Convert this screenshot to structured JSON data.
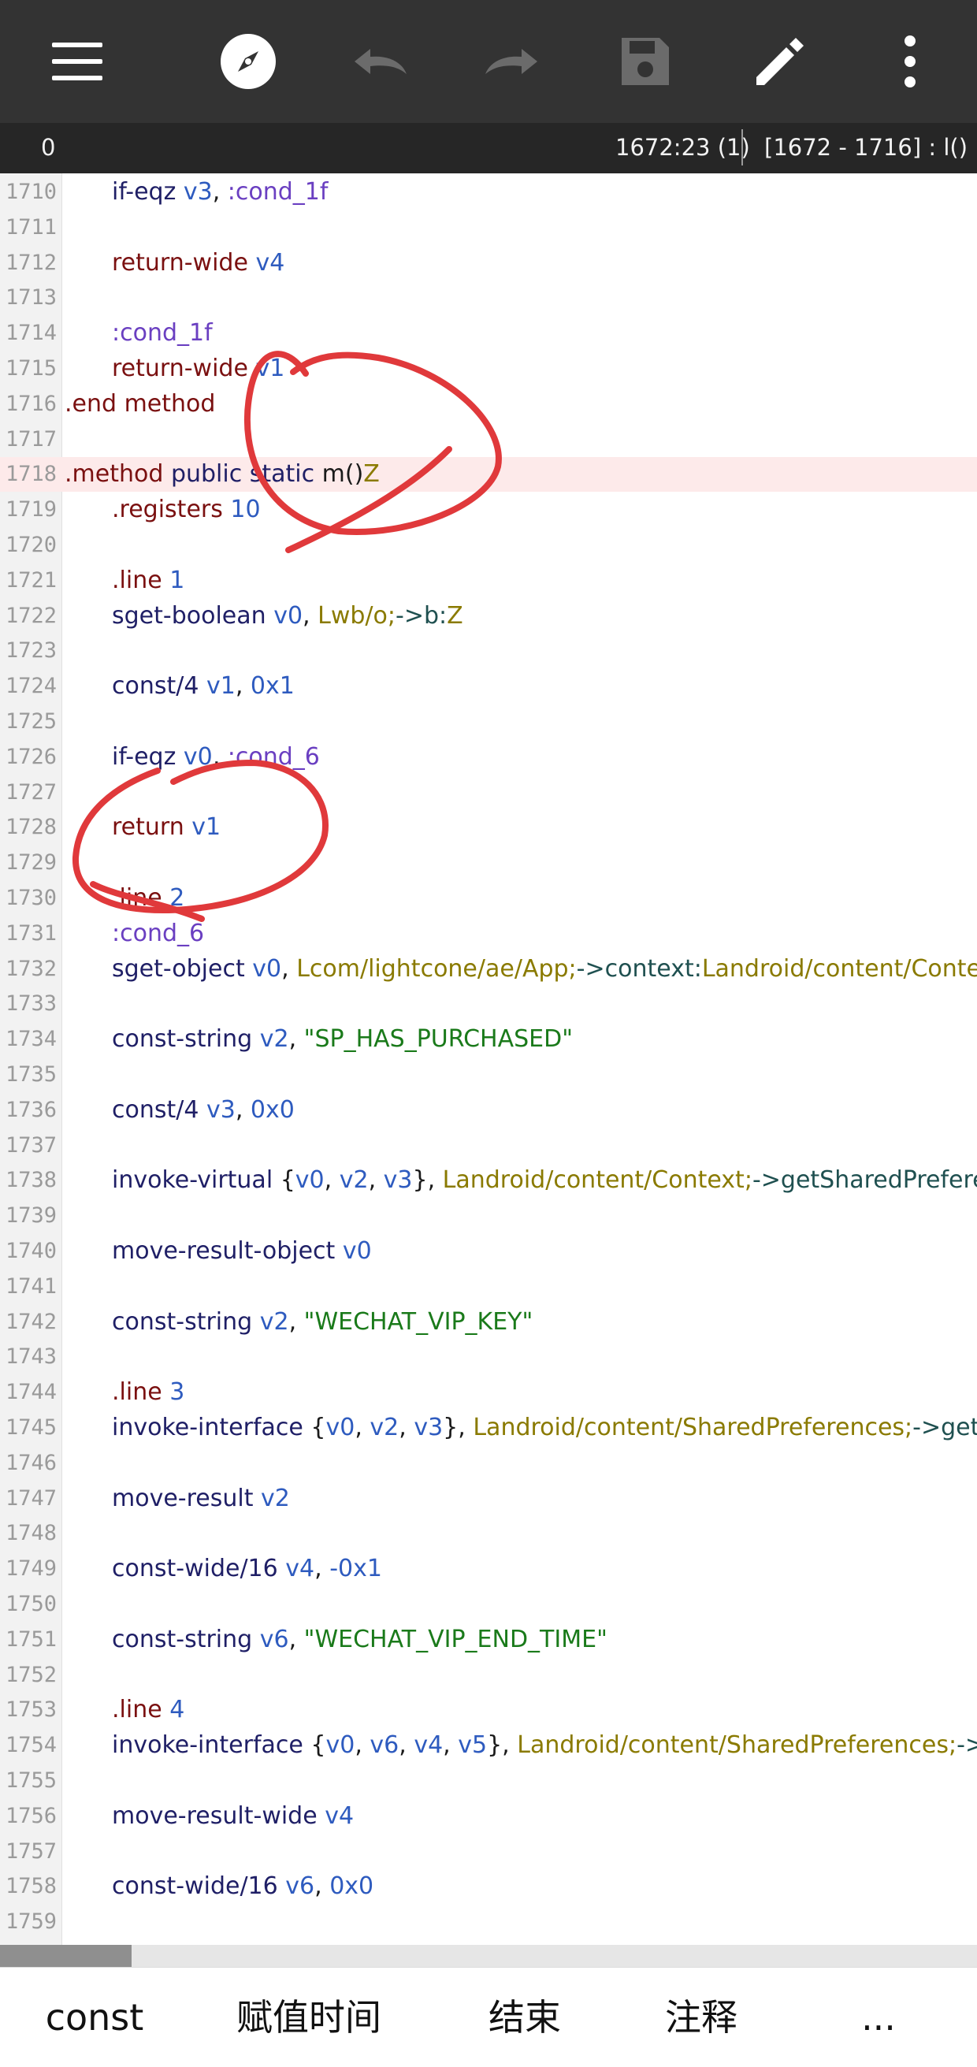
{
  "toolbar": {
    "icons": [
      "menu-icon",
      "compass-icon",
      "undo-icon",
      "redo-icon",
      "save-icon",
      "edit-icon",
      "more-vertical-icon"
    ]
  },
  "status": {
    "left": "0",
    "position": "1672:23 (1)",
    "range": "[1672 - 1716] : l()"
  },
  "editor": {
    "highlighted_line": "1718",
    "lines": [
      {
        "n": "1710",
        "t": [
          [
            "i",
            "if-eqz "
          ],
          [
            "r",
            "v3"
          ],
          [
            "p",
            ", "
          ],
          [
            "l",
            ":cond_1f"
          ]
        ]
      },
      {
        "n": "1711",
        "t": []
      },
      {
        "n": "1712",
        "t": [
          [
            "m",
            "return-wide "
          ],
          [
            "r",
            "v4"
          ]
        ]
      },
      {
        "n": "1713",
        "t": []
      },
      {
        "n": "1714",
        "t": [
          [
            "l",
            ":cond_1f"
          ]
        ]
      },
      {
        "n": "1715",
        "t": [
          [
            "m",
            "return-wide "
          ],
          [
            "r",
            "v1"
          ]
        ]
      },
      {
        "n": "1716",
        "t": [
          [
            "m",
            ".end method"
          ]
        ],
        "d": true
      },
      {
        "n": "1717",
        "t": []
      },
      {
        "n": "1718",
        "t": [
          [
            "m",
            ".method "
          ],
          [
            "i",
            "public static "
          ],
          [
            "x",
            "m()"
          ],
          [
            "y",
            "Z"
          ]
        ],
        "d": true
      },
      {
        "n": "1719",
        "t": [
          [
            "m",
            ".registers "
          ],
          [
            "r",
            "10"
          ]
        ]
      },
      {
        "n": "1720",
        "t": []
      },
      {
        "n": "1721",
        "t": [
          [
            "m",
            ".line "
          ],
          [
            "r",
            "1"
          ]
        ]
      },
      {
        "n": "1722",
        "t": [
          [
            "i",
            "sget-boolean "
          ],
          [
            "r",
            "v0"
          ],
          [
            "p",
            ", "
          ],
          [
            "y",
            "Lwb/o;"
          ],
          [
            "a",
            "->b:"
          ],
          [
            "y",
            "Z"
          ]
        ]
      },
      {
        "n": "1723",
        "t": []
      },
      {
        "n": "1724",
        "t": [
          [
            "i",
            "const/4 "
          ],
          [
            "r",
            "v1"
          ],
          [
            "p",
            ", "
          ],
          [
            "r",
            "0x1"
          ]
        ]
      },
      {
        "n": "1725",
        "t": []
      },
      {
        "n": "1726",
        "t": [
          [
            "i",
            "if-eqz "
          ],
          [
            "r",
            "v0"
          ],
          [
            "p",
            ", "
          ],
          [
            "l",
            ":cond_6"
          ]
        ]
      },
      {
        "n": "1727",
        "t": []
      },
      {
        "n": "1728",
        "t": [
          [
            "m",
            "return "
          ],
          [
            "r",
            "v1"
          ]
        ]
      },
      {
        "n": "1729",
        "t": []
      },
      {
        "n": "1730",
        "t": [
          [
            "m",
            ".line "
          ],
          [
            "r",
            "2"
          ]
        ]
      },
      {
        "n": "1731",
        "t": [
          [
            "l",
            ":cond_6"
          ]
        ]
      },
      {
        "n": "1732",
        "t": [
          [
            "i",
            "sget-object "
          ],
          [
            "r",
            "v0"
          ],
          [
            "p",
            ", "
          ],
          [
            "y",
            "Lcom/lightcone/ae/App;"
          ],
          [
            "a",
            "->context:"
          ],
          [
            "y",
            "Landroid/content/Context;"
          ]
        ]
      },
      {
        "n": "1733",
        "t": []
      },
      {
        "n": "1734",
        "t": [
          [
            "i",
            "const-string "
          ],
          [
            "r",
            "v2"
          ],
          [
            "p",
            ", "
          ],
          [
            "s",
            "\"SP_HAS_PURCHASED\""
          ]
        ]
      },
      {
        "n": "1735",
        "t": []
      },
      {
        "n": "1736",
        "t": [
          [
            "i",
            "const/4 "
          ],
          [
            "r",
            "v3"
          ],
          [
            "p",
            ", "
          ],
          [
            "r",
            "0x0"
          ]
        ]
      },
      {
        "n": "1737",
        "t": []
      },
      {
        "n": "1738",
        "t": [
          [
            "i",
            "invoke-virtual "
          ],
          [
            "p",
            "{"
          ],
          [
            "r",
            "v0"
          ],
          [
            "p",
            ", "
          ],
          [
            "r",
            "v2"
          ],
          [
            "p",
            ", "
          ],
          [
            "r",
            "v3"
          ],
          [
            "p",
            "}, "
          ],
          [
            "y",
            "Landroid/content/Context;"
          ],
          [
            "a",
            "->getSharedPreferences"
          ]
        ]
      },
      {
        "n": "1739",
        "t": []
      },
      {
        "n": "1740",
        "t": [
          [
            "i",
            "move-result-object "
          ],
          [
            "r",
            "v0"
          ]
        ]
      },
      {
        "n": "1741",
        "t": []
      },
      {
        "n": "1742",
        "t": [
          [
            "i",
            "const-string "
          ],
          [
            "r",
            "v2"
          ],
          [
            "p",
            ", "
          ],
          [
            "s",
            "\"WECHAT_VIP_KEY\""
          ]
        ]
      },
      {
        "n": "1743",
        "t": []
      },
      {
        "n": "1744",
        "t": [
          [
            "m",
            ".line "
          ],
          [
            "r",
            "3"
          ]
        ]
      },
      {
        "n": "1745",
        "t": [
          [
            "i",
            "invoke-interface "
          ],
          [
            "p",
            "{"
          ],
          [
            "r",
            "v0"
          ],
          [
            "p",
            ", "
          ],
          [
            "r",
            "v2"
          ],
          [
            "p",
            ", "
          ],
          [
            "r",
            "v3"
          ],
          [
            "p",
            "}, "
          ],
          [
            "y",
            "Landroid/content/SharedPreferences;"
          ],
          [
            "a",
            "->getBoolean"
          ]
        ]
      },
      {
        "n": "1746",
        "t": []
      },
      {
        "n": "1747",
        "t": [
          [
            "i",
            "move-result "
          ],
          [
            "r",
            "v2"
          ]
        ]
      },
      {
        "n": "1748",
        "t": []
      },
      {
        "n": "1749",
        "t": [
          [
            "i",
            "const-wide/16 "
          ],
          [
            "r",
            "v4"
          ],
          [
            "p",
            ", "
          ],
          [
            "r",
            "-0x1"
          ]
        ]
      },
      {
        "n": "1750",
        "t": []
      },
      {
        "n": "1751",
        "t": [
          [
            "i",
            "const-string "
          ],
          [
            "r",
            "v6"
          ],
          [
            "p",
            ", "
          ],
          [
            "s",
            "\"WECHAT_VIP_END_TIME\""
          ]
        ]
      },
      {
        "n": "1752",
        "t": []
      },
      {
        "n": "1753",
        "t": [
          [
            "m",
            ".line "
          ],
          [
            "r",
            "4"
          ]
        ]
      },
      {
        "n": "1754",
        "t": [
          [
            "i",
            "invoke-interface "
          ],
          [
            "p",
            "{"
          ],
          [
            "r",
            "v0"
          ],
          [
            "p",
            ", "
          ],
          [
            "r",
            "v6"
          ],
          [
            "p",
            ", "
          ],
          [
            "r",
            "v4"
          ],
          [
            "p",
            ", "
          ],
          [
            "r",
            "v5"
          ],
          [
            "p",
            "}, "
          ],
          [
            "y",
            "Landroid/content/SharedPreferences;"
          ],
          [
            "a",
            "->getLong"
          ]
        ]
      },
      {
        "n": "1755",
        "t": []
      },
      {
        "n": "1756",
        "t": [
          [
            "i",
            "move-result-wide "
          ],
          [
            "r",
            "v4"
          ]
        ]
      },
      {
        "n": "1757",
        "t": []
      },
      {
        "n": "1758",
        "t": [
          [
            "i",
            "const-wide/16 "
          ],
          [
            "r",
            "v6"
          ],
          [
            "p",
            ", "
          ],
          [
            "r",
            "0x0"
          ]
        ]
      },
      {
        "n": "1759",
        "t": []
      }
    ]
  },
  "scrollbar": {
    "position_fraction": 0.0,
    "visible_fraction": 0.135
  },
  "quickbar": {
    "items": [
      "const",
      "赋值时间",
      "结束",
      "注释",
      "..."
    ]
  },
  "colors": {
    "toolbar_bg": "#333333",
    "statusbar_bg": "#262626",
    "highlight_line": "#fdeaea",
    "annotation": "#e0393b"
  }
}
